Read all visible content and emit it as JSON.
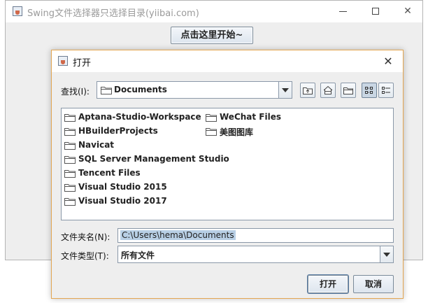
{
  "main_window": {
    "title": "Swing文件选择器只选择目录(yiibai.com)",
    "start_button": "点击这里开始~",
    "controls": {
      "minimize": "minimize",
      "maximize": "maximize",
      "close": "✕"
    }
  },
  "dialog": {
    "title": "打开",
    "close": "✕",
    "look_in_label": "查找(I):",
    "look_in_value": "Documents",
    "toolbar": [
      "up-folder-icon",
      "home-icon",
      "new-folder-icon",
      "list-view-icon",
      "details-view-icon"
    ],
    "files": [
      "Aptana-Studio-Workspace",
      "HBuilderProjects",
      "Navicat",
      "SQL Server Management Studio",
      "Tencent Files",
      "Visual Studio 2015",
      "Visual Studio 2017",
      "WeChat Files",
      "美图图库"
    ],
    "filename_label": "文件夹名(N):",
    "filename_value": "C:\\Users\\hema\\Documents",
    "filetype_label": "文件类型(T):",
    "filetype_value": "所有文件",
    "open_button": "打开",
    "cancel_button": "取消"
  },
  "colors": {
    "dialog_border": "#e3a652",
    "selection": "#b8cfe5"
  }
}
